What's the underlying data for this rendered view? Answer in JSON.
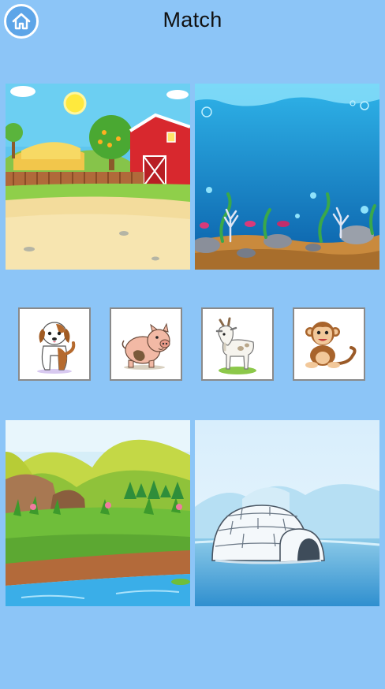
{
  "header": {
    "title": "Match",
    "home_icon": "home-icon"
  },
  "scenes": [
    {
      "id": "farm",
      "icon": "farm-scene"
    },
    {
      "id": "ocean",
      "icon": "ocean-scene"
    },
    {
      "id": "river",
      "icon": "river-scene"
    },
    {
      "id": "arctic",
      "icon": "arctic-igloo-scene"
    }
  ],
  "animals": [
    {
      "id": "dog",
      "icon": "dog-icon"
    },
    {
      "id": "pig",
      "icon": "pig-icon"
    },
    {
      "id": "goat",
      "icon": "goat-icon"
    },
    {
      "id": "monkey",
      "icon": "monkey-icon"
    }
  ],
  "colors": {
    "background": "#8cc5f7",
    "home_button": "#5da5e8"
  }
}
